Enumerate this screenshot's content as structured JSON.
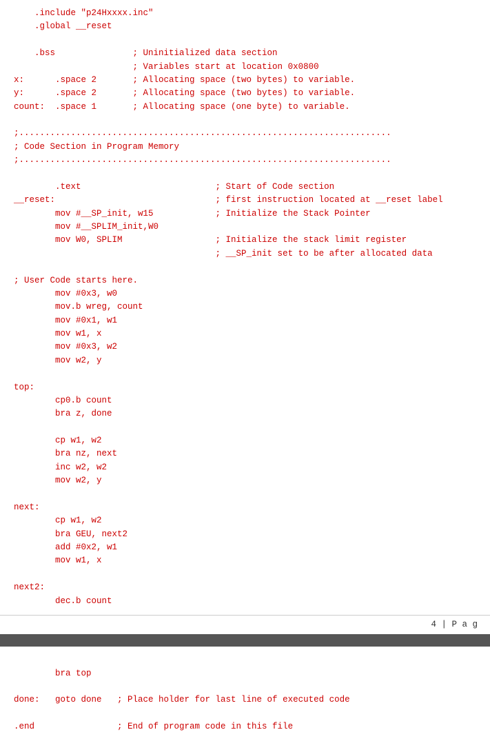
{
  "page1": {
    "code_lines": [
      "    .include \"p24Hxxxx.inc\"",
      "    .global __reset",
      "",
      "    .bss               ; Uninitialized data section",
      "                       ; Variables start at location 0x0800",
      "x:      .space 2       ; Allocating space (two bytes) to variable.",
      "y:      .space 2       ; Allocating space (two bytes) to variable.",
      "count:  .space 1       ; Allocating space (one byte) to variable.",
      "",
      ";........................................................................",
      "; Code Section in Program Memory",
      ";........................................................................",
      "",
      "        .text                          ; Start of Code section",
      "__reset:                               ; first instruction located at __reset label",
      "        mov #__SP_init, w15            ; Initialize the Stack Pointer",
      "        mov #__SPLIM_init,W0",
      "        mov W0, SPLIM                  ; Initialize the stack limit register",
      "                                       ; __SP_init set to be after allocated data",
      "",
      "; User Code starts here.",
      "        mov #0x3, w0",
      "        mov.b wreg, count",
      "        mov #0x1, w1",
      "        mov w1, x",
      "        mov #0x3, w2",
      "        mov w2, y",
      "",
      "top:",
      "        cp0.b count",
      "        bra z, done",
      "",
      "        cp w1, w2",
      "        bra nz, next",
      "        inc w2, w2",
      "        mov w2, y",
      "",
      "next:",
      "        cp w1, w2",
      "        bra GEU, next2",
      "        add #0x2, w1",
      "        mov w1, x",
      "",
      "next2:",
      "        dec.b count"
    ],
    "footer": "4 | P a g"
  },
  "page2": {
    "code_lines": [
      "",
      "        bra top",
      "",
      "done:   goto done   ; Place holder for last line of executed code",
      "",
      ".end                ; End of program code in this file"
    ]
  }
}
